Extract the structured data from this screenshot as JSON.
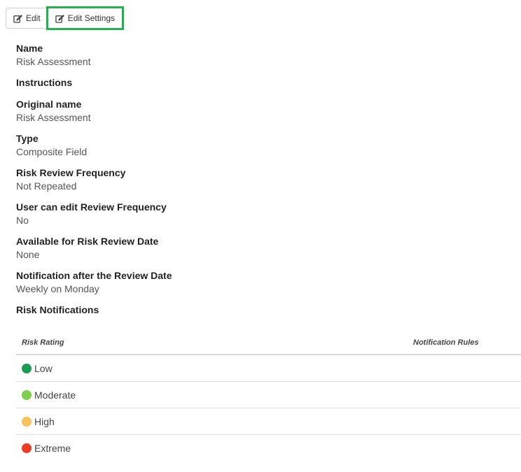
{
  "toolbar": {
    "edit_label": "Edit",
    "edit_settings_label": "Edit Settings"
  },
  "fields": [
    {
      "label": "Name",
      "value": "Risk Assessment"
    },
    {
      "label": "Instructions",
      "value": ""
    },
    {
      "label": "Original name",
      "value": "Risk Assessment"
    },
    {
      "label": "Type",
      "value": "Composite Field"
    },
    {
      "label": "Risk Review Frequency",
      "value": "Not Repeated"
    },
    {
      "label": "User can edit Review Frequency",
      "value": "No"
    },
    {
      "label": "Available for Risk Review Date",
      "value": "None"
    },
    {
      "label": "Notification after the Review Date",
      "value": "Weekly on Monday"
    },
    {
      "label": "Risk Notifications",
      "value": ""
    }
  ],
  "notifications_table": {
    "headers": {
      "rating": "Risk Rating",
      "rules": "Notification Rules"
    },
    "rows": [
      {
        "label": "Low",
        "color": "#1a9c52",
        "rules": ""
      },
      {
        "label": "Moderate",
        "color": "#7dd04a",
        "rules": ""
      },
      {
        "label": "High",
        "color": "#f8c15a",
        "rules": ""
      },
      {
        "label": "Extreme",
        "color": "#ee3b24",
        "rules": ""
      }
    ]
  }
}
